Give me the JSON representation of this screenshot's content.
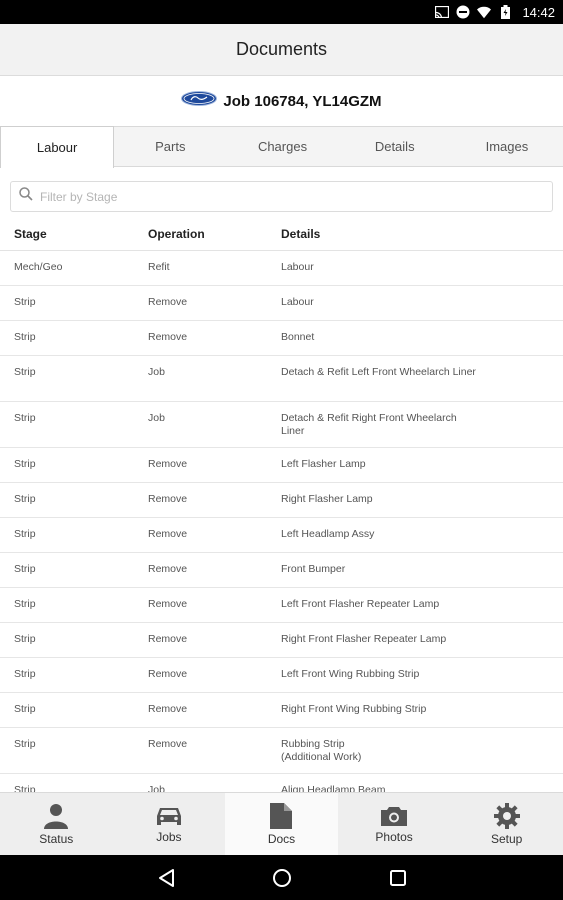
{
  "status_bar": {
    "time": "14:42",
    "icons": [
      "cast-icon",
      "do-not-disturb-icon",
      "wifi-icon",
      "battery-icon"
    ]
  },
  "app_bar": {
    "title": "Documents"
  },
  "job": {
    "brand_logo": "ford-logo",
    "title": "Job 106784, YL14GZM"
  },
  "tabs": [
    {
      "label": "Labour",
      "active": true
    },
    {
      "label": "Parts",
      "active": false
    },
    {
      "label": "Charges",
      "active": false
    },
    {
      "label": "Details",
      "active": false
    },
    {
      "label": "Images",
      "active": false
    }
  ],
  "filter": {
    "placeholder": "Filter by Stage",
    "value": ""
  },
  "table": {
    "headers": {
      "stage": "Stage",
      "operation": "Operation",
      "details": "Details"
    },
    "rows": [
      {
        "stage": "Mech/Geo",
        "operation": "Refit",
        "details": "Labour"
      },
      {
        "stage": "Strip",
        "operation": "Remove",
        "details": "Labour"
      },
      {
        "stage": "Strip",
        "operation": "Remove",
        "details": "Bonnet"
      },
      {
        "stage": "Strip",
        "operation": "Job",
        "details": "Detach & Refit Left Front Wheelarch Liner"
      },
      {
        "stage": "Strip",
        "operation": "Job",
        "details": "Detach & Refit Right Front Wheelarch Liner"
      },
      {
        "stage": "Strip",
        "operation": "Remove",
        "details": "Left Flasher Lamp"
      },
      {
        "stage": "Strip",
        "operation": "Remove",
        "details": "Right Flasher Lamp"
      },
      {
        "stage": "Strip",
        "operation": "Remove",
        "details": "Left Headlamp Assy"
      },
      {
        "stage": "Strip",
        "operation": "Remove",
        "details": "Front Bumper"
      },
      {
        "stage": "Strip",
        "operation": "Remove",
        "details": "Left Front Flasher Repeater Lamp"
      },
      {
        "stage": "Strip",
        "operation": "Remove",
        "details": "Right Front Flasher Repeater Lamp"
      },
      {
        "stage": "Strip",
        "operation": "Remove",
        "details": "Left Front Wing Rubbing Strip"
      },
      {
        "stage": "Strip",
        "operation": "Remove",
        "details": "Right Front Wing Rubbing Strip"
      },
      {
        "stage": "Strip",
        "operation": "Remove",
        "details": "Rubbing Strip\n(Additional Work)"
      },
      {
        "stage": "Strip",
        "operation": "Job",
        "details": "Align Headlamp Beam"
      }
    ]
  },
  "bottom_nav": [
    {
      "label": "Status",
      "icon": "person-icon",
      "active": false
    },
    {
      "label": "Jobs",
      "icon": "car-icon",
      "active": false
    },
    {
      "label": "Docs",
      "icon": "document-icon",
      "active": true
    },
    {
      "label": "Photos",
      "icon": "camera-icon",
      "active": false
    },
    {
      "label": "Setup",
      "icon": "gear-icon",
      "active": false
    }
  ],
  "system_nav": [
    "back-icon",
    "home-icon",
    "recents-icon"
  ],
  "colors": {
    "ford_blue": "#1f4a9c",
    "icon_gray": "#555555",
    "active_tab_bg": "#ffffff"
  }
}
